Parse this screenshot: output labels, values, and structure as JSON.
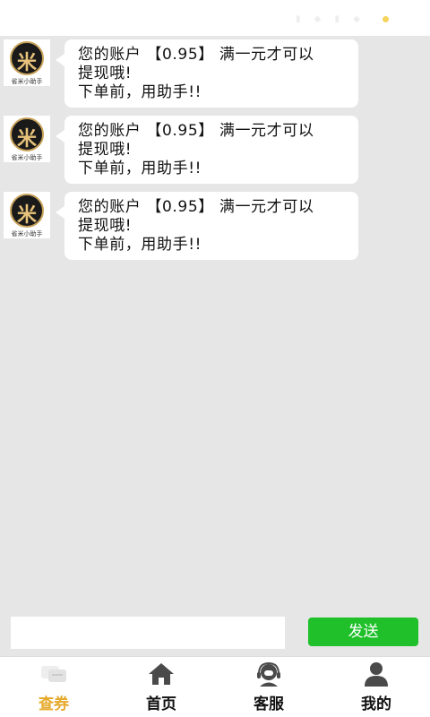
{
  "status_bar": {
    "faint_icons": "▮ ◆ ▮ ◆"
  },
  "avatar": {
    "glyph": "米",
    "caption": "省米小助手"
  },
  "messages": [
    {
      "text": "您的账户 【0.95】 满一元才可以\n提现哦!\n下单前，用助手!!"
    },
    {
      "text": "您的账户 【0.95】 满一元才可以\n提现哦!\n下单前，用助手!!"
    },
    {
      "text": "您的账户 【0.95】 满一元才可以\n提现哦!\n下单前，用助手!!"
    }
  ],
  "composer": {
    "input_value": "",
    "placeholder": "",
    "send_label": "发送"
  },
  "tabbar": {
    "active": "查券",
    "items": [
      {
        "label": "查券",
        "icon": "coupon-icon"
      },
      {
        "label": "首页",
        "icon": "home-icon"
      },
      {
        "label": "客服",
        "icon": "customer-service-icon"
      },
      {
        "label": "我的",
        "icon": "user-icon"
      }
    ]
  },
  "colors": {
    "accent": "#e5a92a",
    "send": "#1fc02a",
    "chat_bg": "#e6e6e6",
    "status_dot": "#f4d35e"
  }
}
